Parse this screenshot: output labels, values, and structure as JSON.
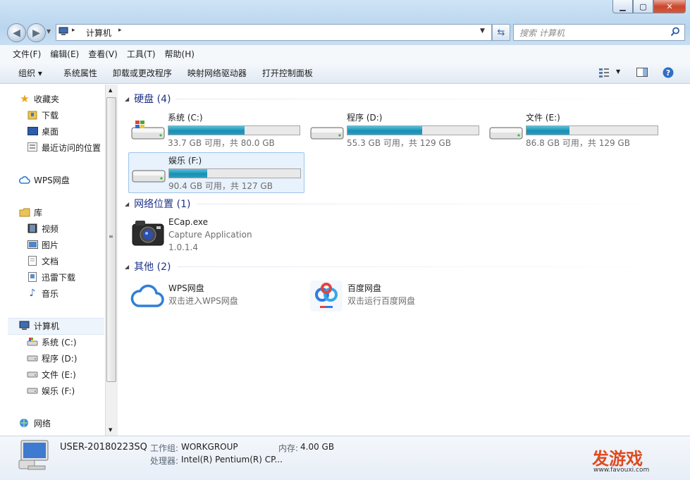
{
  "window": {
    "controls": {
      "minimize": "▁",
      "maximize": "▢",
      "close": "✕"
    }
  },
  "address": {
    "location": "计算机",
    "separator": "▸"
  },
  "search": {
    "placeholder": "搜索 计算机"
  },
  "menu": [
    "文件(F)",
    "编辑(E)",
    "查看(V)",
    "工具(T)",
    "帮助(H)"
  ],
  "commands": [
    "组织 ▾",
    "系统属性",
    "卸载或更改程序",
    "映射网络驱动器",
    "打开控制面板"
  ],
  "nav": {
    "favorites": "收藏夹",
    "downloads": "下载",
    "desktop": "桌面",
    "recent": "最近访问的位置",
    "wps": "WPS网盘",
    "library": "库",
    "video": "视频",
    "pictures": "图片",
    "documents": "文档",
    "xunlei": "迅雷下载",
    "music": "音乐",
    "computer": "计算机",
    "drive_c": "系统 (C:)",
    "drive_d": "程序 (D:)",
    "drive_e": "文件 (E:)",
    "drive_f": "娱乐 (F:)",
    "network": "网络"
  },
  "groups": {
    "hdd": "硬盘 (4)",
    "netloc": "网络位置 (1)",
    "other": "其他 (2)"
  },
  "drives": [
    {
      "name": "系统 (C:)",
      "free": "33.7 GB 可用，共 80.0 GB",
      "used_fraction": 0.58
    },
    {
      "name": "程序 (D:)",
      "free": "55.3 GB 可用，共 129 GB",
      "used_fraction": 0.57
    },
    {
      "name": "文件 (E:)",
      "free": "86.8 GB 可用，共 129 GB",
      "used_fraction": 0.33
    },
    {
      "name": "娱乐 (F:)",
      "free": "90.4 GB 可用，共 127 GB",
      "used_fraction": 0.29
    }
  ],
  "ecap": {
    "name": "ECap.exe",
    "desc": "Capture Application",
    "version": "1.0.1.4"
  },
  "wps_disk": {
    "name": "WPS网盘",
    "desc": "双击进入WPS网盘"
  },
  "baidu_disk": {
    "name": "百度网盘",
    "desc": "双击运行百度网盘"
  },
  "details": {
    "computer_name": "USER-20180223SQ",
    "workgroup_label": "工作组:",
    "workgroup": "WORKGROUP",
    "memory_label": "内存:",
    "memory": "4.00 GB",
    "cpu_label": "处理器:",
    "cpu": "Intel(R) Pentium(R) CP..."
  },
  "watermark": {
    "brand": "发游戏",
    "url": "www.favouxi.com"
  },
  "colors": {
    "group_header": "#1e3287",
    "bar_fill": "#1a8fb3",
    "selection": "#e8f2fc"
  }
}
